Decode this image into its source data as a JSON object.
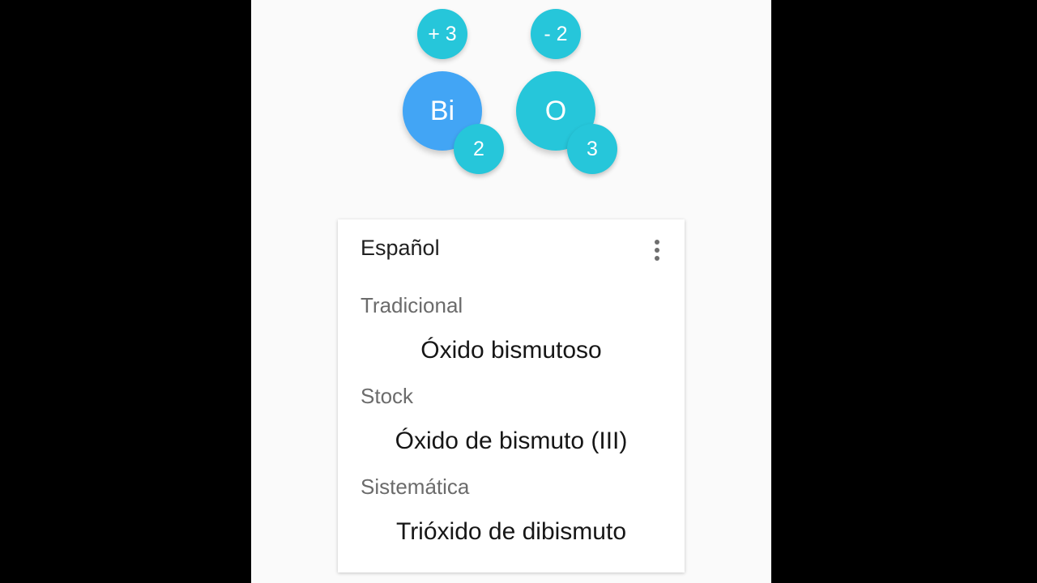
{
  "compound": {
    "elements": [
      {
        "symbol": "Bi",
        "charge": "+ 3",
        "subscript": "2",
        "color": "#42a5f5"
      },
      {
        "symbol": "O",
        "charge": "- 2",
        "subscript": "3",
        "color": "#26c6da"
      }
    ],
    "badge_color": "#26c6da"
  },
  "card": {
    "language": "Español",
    "menu_icon": "more-vert-icon",
    "sections": [
      {
        "label": "Tradicional",
        "value": "Óxido bismutoso"
      },
      {
        "label": "Stock",
        "value": "Óxido de bismuto (III)"
      },
      {
        "label": "Sistemática",
        "value": "Trióxido de dibismuto"
      }
    ]
  }
}
